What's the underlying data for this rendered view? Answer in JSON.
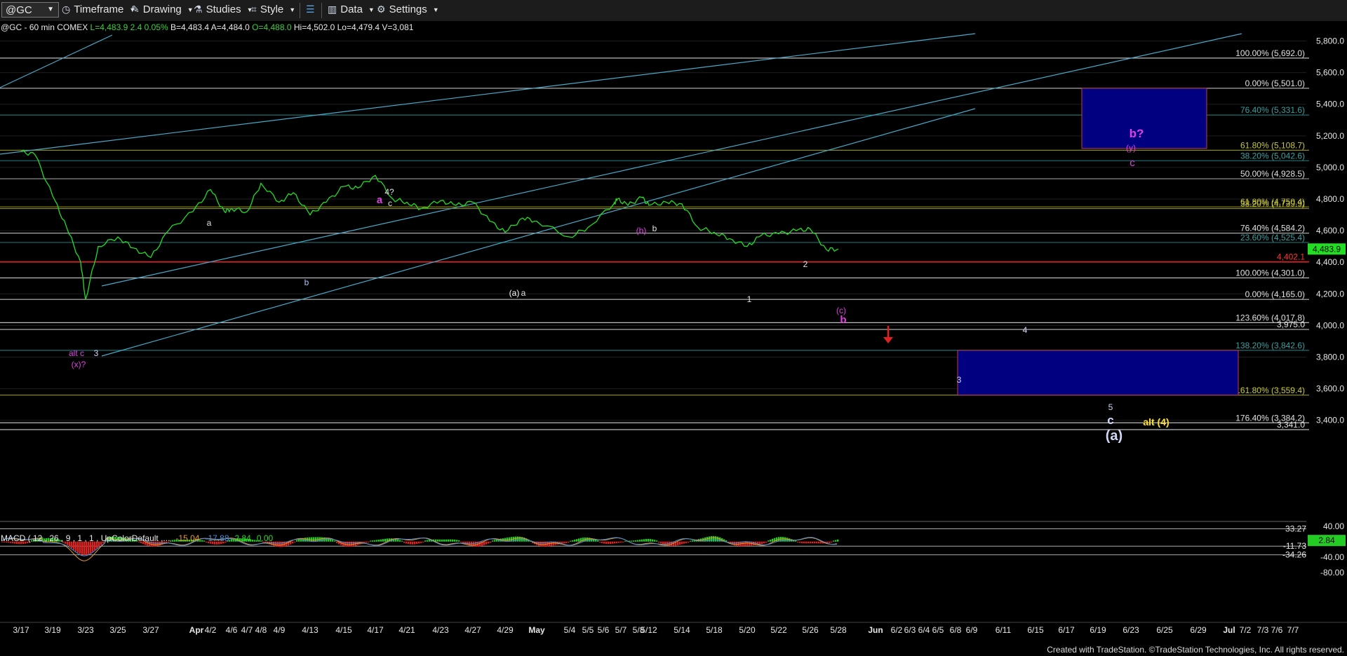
{
  "toolbar": {
    "symbol": "@GC",
    "items": [
      {
        "label": "Timeframe",
        "icon": "clock-icon"
      },
      {
        "label": "Drawing",
        "icon": "pencil-icon"
      },
      {
        "label": "Studies",
        "icon": "flask-icon"
      },
      {
        "label": "Style",
        "icon": "style-icon"
      },
      {
        "label": "Data",
        "icon": "bar-chart-icon"
      },
      {
        "label": "Settings",
        "icon": "gear-icon"
      }
    ]
  },
  "info_line": {
    "symbol": "@GC - 60 min  COMEX",
    "last": "L=4,483.9",
    "change": "2.4",
    "change_pct": "0.05%",
    "bid": "B=4,483.4",
    "ask": "A=4,484.0",
    "open": "O=4,488.0",
    "high": "Hi=4,502.0",
    "low": "Lo=4,479.4",
    "volume": "V=3,081"
  },
  "footer_credit": "Created with TradeStation. ©TradeStation Technologies, Inc. All rights reserved.",
  "colors": {
    "price": "#22dd22",
    "background": "#000000",
    "channel": "#4aa8c8",
    "support_line": "#e02020",
    "target_box": "#000080",
    "magenta_label": "#e040e0",
    "yellow_label": "#ffe030",
    "macd_line": "#4f8fd6",
    "signal_line": "#e89a2a",
    "hist_pos": "#22cc22",
    "hist_neg": "#dd2020"
  },
  "chart_data": {
    "type": "line",
    "title": "@GC - 60 min  COMEX",
    "y_axis_ticks": [
      "5,800.0",
      "5,600.0",
      "5,400.0",
      "5,200.0",
      "5,000.0",
      "4,800.0",
      "4,600.0",
      "4,400.0",
      "4,200.0",
      "4,000.0",
      "3,800.0",
      "3,600.0",
      "3,400.0"
    ],
    "ylim": [
      3341,
      5900
    ],
    "last_price": "4,483.9",
    "x_axis_labels": [
      "3/17",
      "3/19",
      "3/23",
      "3/25",
      "3/27",
      "Apr",
      "4/2",
      "4/6",
      "4/7",
      "4/8",
      "4/9",
      "4/13",
      "4/15",
      "4/17",
      "4/21",
      "4/23",
      "4/27",
      "4/29",
      "May",
      "5/4",
      "5/5",
      "5/6",
      "5/7",
      "5/8",
      "5/12",
      "5/14",
      "5/18",
      "5/20",
      "5/22",
      "5/26",
      "5/28",
      "Jun",
      "6/2",
      "6/3",
      "6/4",
      "6/5",
      "6/8",
      "6/9",
      "6/11",
      "6/15",
      "6/17",
      "6/19",
      "6/23",
      "6/25",
      "6/29",
      "Jul",
      "7/2",
      "7/3",
      "7/6",
      "7/7"
    ],
    "price_series": [
      {
        "date": "3/17",
        "price": 5100
      },
      {
        "date": "3/18",
        "price": 5080
      },
      {
        "date": "3/19",
        "price": 4820
      },
      {
        "date": "3/20",
        "price": 4620
      },
      {
        "date": "3/22",
        "price": 4400
      },
      {
        "date": "3/23",
        "price": 4165
      },
      {
        "date": "3/24",
        "price": 4500
      },
      {
        "date": "3/25",
        "price": 4560
      },
      {
        "date": "3/26",
        "price": 4490
      },
      {
        "date": "3/27",
        "price": 4430
      },
      {
        "date": "3/30",
        "price": 4600
      },
      {
        "date": "Apr 1",
        "price": 4720
      },
      {
        "date": "4/2",
        "price": 4860
      },
      {
        "date": "4/3",
        "price": 4720
      },
      {
        "date": "4/6",
        "price": 4740
      },
      {
        "date": "4/7",
        "price": 4720
      },
      {
        "date": "4/8",
        "price": 4900
      },
      {
        "date": "4/9",
        "price": 4780
      },
      {
        "date": "4/10",
        "price": 4840
      },
      {
        "date": "4/13",
        "price": 4700
      },
      {
        "date": "4/14",
        "price": 4780
      },
      {
        "date": "4/15",
        "price": 4880
      },
      {
        "date": "4/16",
        "price": 4870
      },
      {
        "date": "4/17",
        "price": 4950
      },
      {
        "date": "4/20",
        "price": 4800
      },
      {
        "date": "4/21",
        "price": 4780
      },
      {
        "date": "4/22",
        "price": 4740
      },
      {
        "date": "4/23",
        "price": 4790
      },
      {
        "date": "4/24",
        "price": 4760
      },
      {
        "date": "4/27",
        "price": 4780
      },
      {
        "date": "4/28",
        "price": 4660
      },
      {
        "date": "4/29",
        "price": 4590
      },
      {
        "date": "4/30",
        "price": 4680
      },
      {
        "date": "May 1",
        "price": 4660
      },
      {
        "date": "5/4",
        "price": 4560
      },
      {
        "date": "5/5",
        "price": 4620
      },
      {
        "date": "5/6",
        "price": 4770
      },
      {
        "date": "5/7",
        "price": 4800
      },
      {
        "date": "5/8",
        "price": 4760
      },
      {
        "date": "5/11",
        "price": 4810
      },
      {
        "date": "5/12",
        "price": 4760
      },
      {
        "date": "5/13",
        "price": 4780
      },
      {
        "date": "5/14",
        "price": 4770
      },
      {
        "date": "5/15",
        "price": 4620
      },
      {
        "date": "5/18",
        "price": 4590
      },
      {
        "date": "5/19",
        "price": 4550
      },
      {
        "date": "5/20",
        "price": 4500
      },
      {
        "date": "5/21",
        "price": 4570
      },
      {
        "date": "5/22",
        "price": 4580
      },
      {
        "date": "5/25",
        "price": 4600
      },
      {
        "date": "5/26",
        "price": 4610
      },
      {
        "date": "5/27",
        "price": 4480
      },
      {
        "date": "5/28",
        "price": 4483.9
      }
    ],
    "horizontal_levels": [
      {
        "label": "100.00% (5,692.0)",
        "value": 5692.0
      },
      {
        "label": "0.00% (5,501.0)",
        "value": 5501.0
      },
      {
        "label": "76.40% (5,331.6)",
        "value": 5331.6
      },
      {
        "label": "61.80% (5,108.7)",
        "value": 5108.7
      },
      {
        "label": "38.20% (5,042.6)",
        "value": 5042.6
      },
      {
        "label": "50.00% (4,928.5)",
        "value": 4928.5
      },
      {
        "label": "61.80% (4,750.4)",
        "value": 4750.4
      },
      {
        "label": "38.20% (4,739.9)",
        "value": 4739.9
      },
      {
        "label": "76.40% (4,584.2)",
        "value": 4584.2
      },
      {
        "label": "23.60% (4,525.4)",
        "value": 4525.4
      },
      {
        "label": "4,402.1",
        "value": 4402.1
      },
      {
        "label": "100.00% (4,301.0)",
        "value": 4301.0
      },
      {
        "label": "0.00% (4,165.0)",
        "value": 4165.0
      },
      {
        "label": "123.60% (4,017.8)",
        "value": 4017.8
      },
      {
        "label": "3,975.0",
        "value": 3975.0
      },
      {
        "label": "138.20% (3,842.6)",
        "value": 3842.6
      },
      {
        "label": "161.80% (3,559.4)",
        "value": 3559.4
      },
      {
        "label": "176.40% (3,384.2)",
        "value": 3384.2
      },
      {
        "label": "3,341.0",
        "value": 3341.0
      }
    ],
    "wave_labels": [
      {
        "text": "a",
        "date": "4/2",
        "price": 4870
      },
      {
        "text": "b",
        "date": "4/13",
        "price": 4580
      },
      {
        "text": "a",
        "date": "4/17",
        "price": 4980
      },
      {
        "text": "4?",
        "date": "4/17",
        "price": 5005
      },
      {
        "text": "c",
        "date": "4/17",
        "price": 4970
      },
      {
        "text": "(a)",
        "date": "4/29",
        "price": 4540
      },
      {
        "text": "a",
        "date": "4/30",
        "price": 4540
      },
      {
        "text": "(b)",
        "date": "5/11",
        "price": 4830
      },
      {
        "text": "b",
        "date": "5/12",
        "price": 4835
      },
      {
        "text": "1",
        "date": "5/20",
        "price": 4470
      },
      {
        "text": "2",
        "date": "5/26",
        "price": 4640
      },
      {
        "text": "(c)",
        "date": "5/28",
        "price": 4390
      },
      {
        "text": "b",
        "date": "5/28",
        "price": 4325
      },
      {
        "text": "4",
        "date": "6/11",
        "price": 4250
      },
      {
        "text": "3",
        "date": "6/5",
        "price": 3950
      },
      {
        "text": "alt c",
        "date": "3/21",
        "price": 4210
      },
      {
        "text": "3",
        "date": "3/23",
        "price": 4210
      },
      {
        "text": "(x)?",
        "date": "3/21",
        "price": 4130
      },
      {
        "text": "5",
        "date": "6/23",
        "price": 3790
      },
      {
        "text": "c",
        "date": "6/23",
        "price": 3720
      },
      {
        "text": "(a)",
        "date": "6/23",
        "price": 3620
      },
      {
        "text": "alt (4)",
        "date": "6/26",
        "price": 3680
      },
      {
        "text": "b?",
        "date": "6/23",
        "price": 5430
      },
      {
        "text": "(y)",
        "date": "6/23",
        "price": 5330
      },
      {
        "text": "c",
        "date": "6/23",
        "price": 5230
      }
    ],
    "target_boxes": [
      {
        "name": "upper-box",
        "price_top": 5501,
        "price_bottom": 5120,
        "date_from": "6/19",
        "date_to": "6/29"
      },
      {
        "name": "lower-box",
        "price_top": 3842.6,
        "price_bottom": 3559.4,
        "date_from": "6/5",
        "date_to": "7/1"
      }
    ]
  },
  "macd": {
    "label": "MACD ( 12 , 26 , 9 , 1 , 1 , UpColorDefault ,...",
    "macd_value": "-15.04",
    "signal_value": "-17.88",
    "diff_value": "2.84",
    "zero_value": "0.00",
    "y_axis_ticks": [
      "40.00",
      "-40.00",
      "-80.00"
    ],
    "axis_values": [
      "33.27",
      "-11.73",
      "-34.26"
    ],
    "last_value": "2.84",
    "ylim": [
      -95,
      45
    ]
  }
}
